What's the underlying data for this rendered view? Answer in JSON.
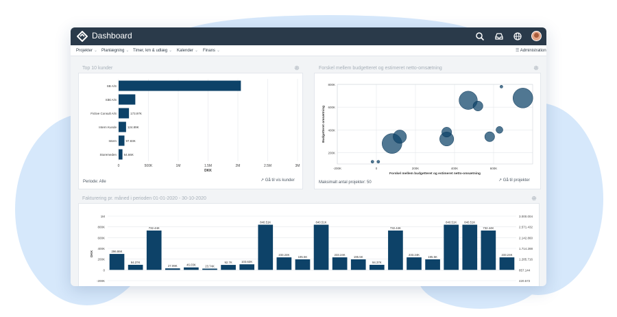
{
  "app": {
    "title": "Dashboard",
    "brand_color": "#2a3a4a",
    "accent_color": "#0d4268"
  },
  "header_icons": [
    "search-icon",
    "inbox-icon",
    "globe-icon",
    "avatar"
  ],
  "menu": {
    "items": [
      {
        "label": "Projekter"
      },
      {
        "label": "Planlægning"
      },
      {
        "label": "Timer, km & udlæg"
      },
      {
        "label": "Kalender"
      },
      {
        "label": "Finans"
      }
    ],
    "admin_label": "Administration"
  },
  "top_customers": {
    "title": "Top 10 kunder",
    "period": "Periode: Alle",
    "link_label": "Gå til vis kunder",
    "chart_data": {
      "type": "bar",
      "orientation": "horizontal",
      "categories": [
        "SB A/S",
        "SiBi A/S",
        "Fictive Consult A/S",
        "Intern Kunde",
        "Intern",
        "Storemeden"
      ],
      "values": [
        2050000,
        280000,
        173970,
        124890,
        97830,
        64660
      ],
      "data_labels": [
        "",
        "",
        "173.97K",
        "124.89K",
        "97.83K",
        "64.66K"
      ],
      "xlabel": "DKK",
      "xlim": [
        0,
        3000000
      ],
      "ticks": [
        0,
        500000,
        1000000,
        1500000,
        2000000,
        2500000,
        3000000
      ],
      "tick_labels": [
        "0",
        "500K",
        "1M",
        "1.5M",
        "2M",
        "2.5M",
        "3M"
      ],
      "grid": true,
      "color": "#0d4268"
    }
  },
  "budget_vs_estimate": {
    "title": "Forskel mellem budgetteret og estimeret netto-omsætning",
    "footer": "Maksimalt antal projekter: 50",
    "link_label": "Gå til projekter",
    "chart_data": {
      "type": "scatter",
      "xlabel": "Forskel mellem budgetteret og estimeret netto-omsætning",
      "ylabel": "Budgetteret omsætning",
      "xlim": [
        -200000,
        800000
      ],
      "ylim": [
        100000,
        800000
      ],
      "x_ticks": [
        -200000,
        0,
        200000,
        400000,
        600000
      ],
      "x_tick_labels": [
        "-200K",
        "0",
        "200K",
        "400K",
        "600K"
      ],
      "y_ticks": [
        200000,
        400000,
        600000,
        800000
      ],
      "y_tick_labels": [
        "200K",
        "400K",
        "600K",
        "800K"
      ],
      "points": [
        {
          "x": 80000,
          "y": 280000,
          "size": 100
        },
        {
          "x": 120000,
          "y": 340000,
          "size": 45
        },
        {
          "x": 360000,
          "y": 320000,
          "size": 50
        },
        {
          "x": 360000,
          "y": 380000,
          "size": 25
        },
        {
          "x": 470000,
          "y": 660000,
          "size": 85
        },
        {
          "x": 520000,
          "y": 610000,
          "size": 25
        },
        {
          "x": 580000,
          "y": 340000,
          "size": 25
        },
        {
          "x": 630000,
          "y": 400000,
          "size": 12
        },
        {
          "x": 750000,
          "y": 680000,
          "size": 100
        },
        {
          "x": -20000,
          "y": 120000,
          "size": 2
        },
        {
          "x": 10000,
          "y": 120000,
          "size": 2
        },
        {
          "x": 640000,
          "y": 780000,
          "size": 2
        }
      ],
      "color": "#0d4268"
    }
  },
  "invoicing": {
    "title": "Fakturering pr. måned i perioden 01-01-2020 - 30-10-2020",
    "chart_data": {
      "type": "bar",
      "ylabel": "DKK",
      "ylim": [
        -200000,
        1000000
      ],
      "y_ticks": [
        -200000,
        0,
        200000,
        400000,
        600000,
        800000,
        1000000
      ],
      "y_tick_labels": [
        "-200K",
        "0",
        "200K",
        "400K",
        "600K",
        "800K",
        "1M"
      ],
      "y2_tick_labels": [
        "420.572",
        "857.144",
        "1.285.716",
        "1.714.288",
        "2.142.860",
        "2.571.432",
        "3.000.004"
      ],
      "values": [
        296860,
        94370,
        732440,
        27990,
        46030,
        23740,
        92700,
        103630,
        840510,
        233240,
        195500,
        840510,
        233240,
        195500,
        94370,
        732440,
        233240,
        195500,
        840510,
        840510,
        732440,
        233240
      ],
      "data_labels": [
        "296.86K",
        "94.37K",
        "732.44K",
        "27.99K",
        "46.03K",
        "23.74K",
        "92.7K",
        "103.63K",
        "840.51K",
        "233.24K",
        "195.5K",
        "840.51K",
        "233.24K",
        "195.5K",
        "94.37K",
        "732.44K",
        "233.24K",
        "195.5K",
        "840.51K",
        "840.51K",
        "732.44K",
        "233.24K"
      ],
      "color": "#0d4268"
    }
  }
}
